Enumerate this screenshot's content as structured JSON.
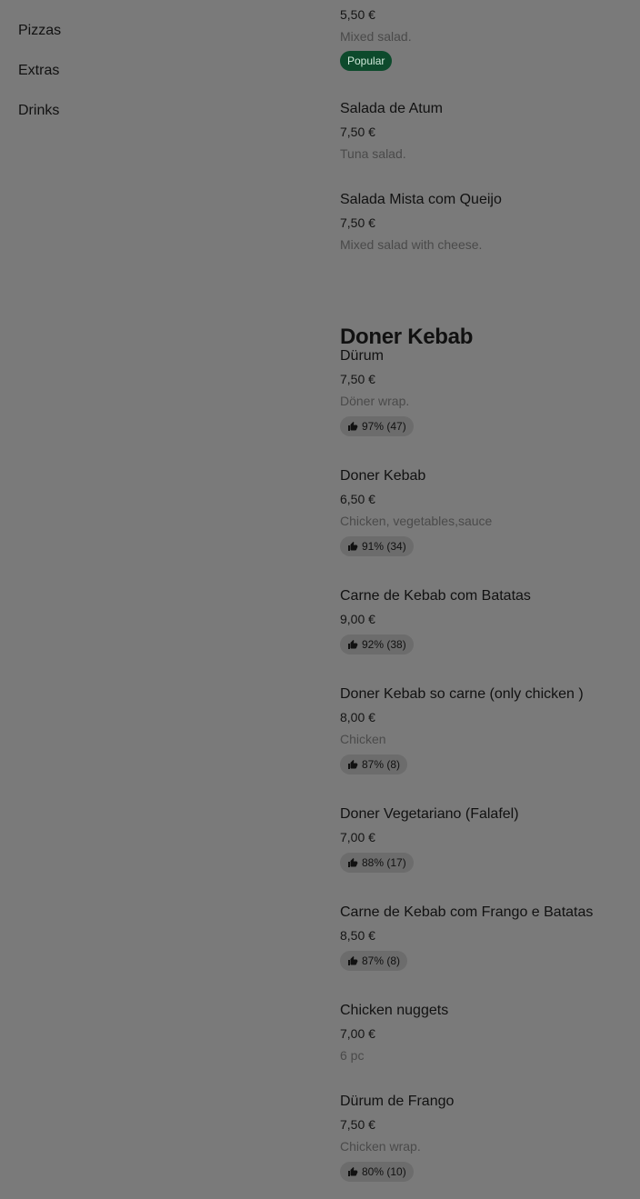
{
  "sidebar": {
    "items": [
      {
        "label": "Pizzas"
      },
      {
        "label": "Extras"
      },
      {
        "label": "Drinks"
      }
    ]
  },
  "menu": {
    "top_item": {
      "price": "5,50 €",
      "description": "Mixed salad.",
      "badge": "Popular"
    },
    "salads": [
      {
        "name": "Salada de Atum",
        "price": "7,50 €",
        "description": "Tuna salad."
      },
      {
        "name": "Salada Mista com Queijo",
        "price": "7,50 €",
        "description": "Mixed salad with cheese."
      }
    ],
    "doner_section": {
      "title": "Doner Kebab",
      "items": [
        {
          "name": "Dürum",
          "price": "7,50 €",
          "description": "Döner wrap.",
          "rating": "97% (47)"
        },
        {
          "name": "Doner Kebab",
          "price": "6,50 €",
          "description": "Chicken, vegetables,sauce",
          "rating": "91% (34)"
        },
        {
          "name": "Carne de Kebab com Batatas",
          "price": "9,00 €",
          "rating": "92% (38)"
        },
        {
          "name": "Doner Kebab so carne (only chicken )",
          "price": "8,00 €",
          "description": "Chicken",
          "rating": "87% (8)"
        },
        {
          "name": "Doner Vegetariano (Falafel)",
          "price": "7,00 €",
          "rating": "88% (17)"
        },
        {
          "name": "Carne de Kebab com Frango e Batatas",
          "price": "8,50 €",
          "rating": "87% (8)"
        },
        {
          "name": "Chicken nuggets",
          "price": "7,00 €",
          "description": "6 pc"
        },
        {
          "name": "Dürum de Frango",
          "price": "7,50 €",
          "description": "Chicken wrap.",
          "rating": "80% (10)"
        }
      ]
    }
  },
  "colors": {
    "overlay_background": "#7a7a7a",
    "popular_badge": "#0d4a2c",
    "rating_pill": "#6c6c6c"
  },
  "icons": {
    "rating": "thumbs-up-icon"
  }
}
